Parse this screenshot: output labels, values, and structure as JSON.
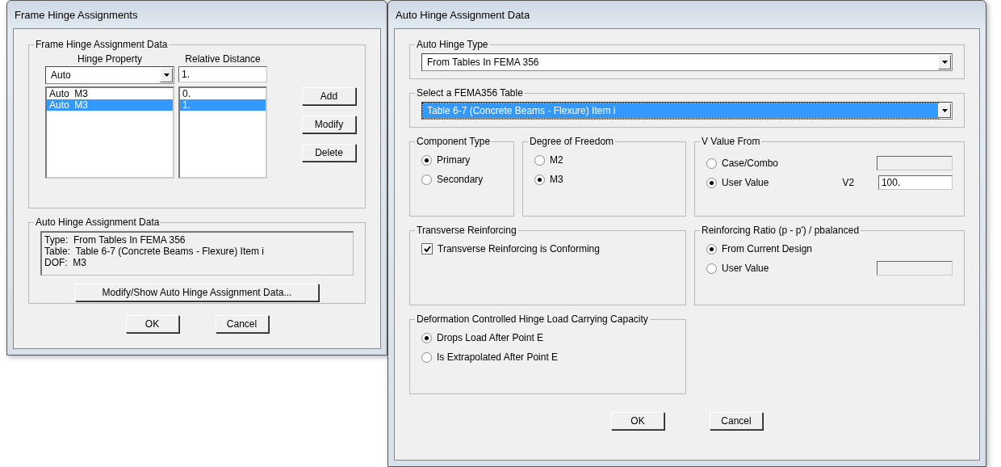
{
  "frame_hinge_window": {
    "title": "Frame Hinge Assignments",
    "assignment_group": {
      "label": "Frame Hinge Assignment Data",
      "hinge_property_header": "Hinge Property",
      "relative_distance_header": "Relative Distance",
      "hinge_property_value": "Auto",
      "relative_distance_value": "1.",
      "rows": [
        {
          "hinge_property": "Auto  M3",
          "relative_distance": "0.",
          "selected": false
        },
        {
          "hinge_property": "Auto  M3",
          "relative_distance": "1.",
          "selected": true
        }
      ],
      "buttons": [
        "Add",
        "Modify",
        "Delete"
      ]
    },
    "auto_group": {
      "label": "Auto Hinge Assignment Data",
      "lines": [
        "Type:  From Tables In FEMA 356",
        "Table:  Table 6-7 (Concrete Beams - Flexure) Item i",
        "DOF:  M3"
      ],
      "button": "Modify/Show Auto Hinge Assignment Data..."
    },
    "buttons": [
      "OK",
      "Cancel"
    ]
  },
  "auto_hinge_window": {
    "title": "Auto Hinge Assignment Data",
    "auto_hinge_type": {
      "label": "Auto Hinge Type",
      "value": "From Tables In FEMA 356",
      "highlighted": false
    },
    "fema_table": {
      "label": "Select a FEMA356 Table",
      "value": "Table 6-7 (Concrete Beams - Flexure) Item i",
      "highlighted": true
    },
    "component_type": {
      "label": "Component Type",
      "options": [
        {
          "label": "Primary",
          "selected": true
        },
        {
          "label": "Secondary",
          "selected": false
        }
      ]
    },
    "degree_of_freedom": {
      "label": "Degree of Freedom",
      "options": [
        {
          "label": "M2",
          "selected": false
        },
        {
          "label": "M3",
          "selected": true
        }
      ]
    },
    "v_value_from": {
      "label": "V Value From",
      "options": [
        {
          "label": "Case/Combo",
          "selected": false,
          "field": {
            "enabled": false
          }
        },
        {
          "label": "User Value",
          "selected": true,
          "field": {
            "label": "V2",
            "value": "100.",
            "enabled": true
          }
        }
      ]
    },
    "transverse_reinforcing": {
      "label": "Transverse Reinforcing",
      "checkbox": {
        "label": "Transverse Reinforcing is Conforming",
        "checked": true
      }
    },
    "reinforcing_ratio": {
      "label": "Reinforcing Ratio  (p - p') / pbalanced",
      "options": [
        {
          "label": "From Current Design",
          "selected": true
        },
        {
          "label": "User Value",
          "selected": false,
          "field": {
            "enabled": false
          }
        }
      ]
    },
    "load_capacity": {
      "label": "Deformation Controlled Hinge Load Carrying Capacity",
      "options": [
        {
          "label": "Drops Load After Point E",
          "selected": true
        },
        {
          "label": "Is Extrapolated After Point E",
          "selected": false
        }
      ]
    },
    "buttons": [
      "OK",
      "Cancel"
    ]
  }
}
